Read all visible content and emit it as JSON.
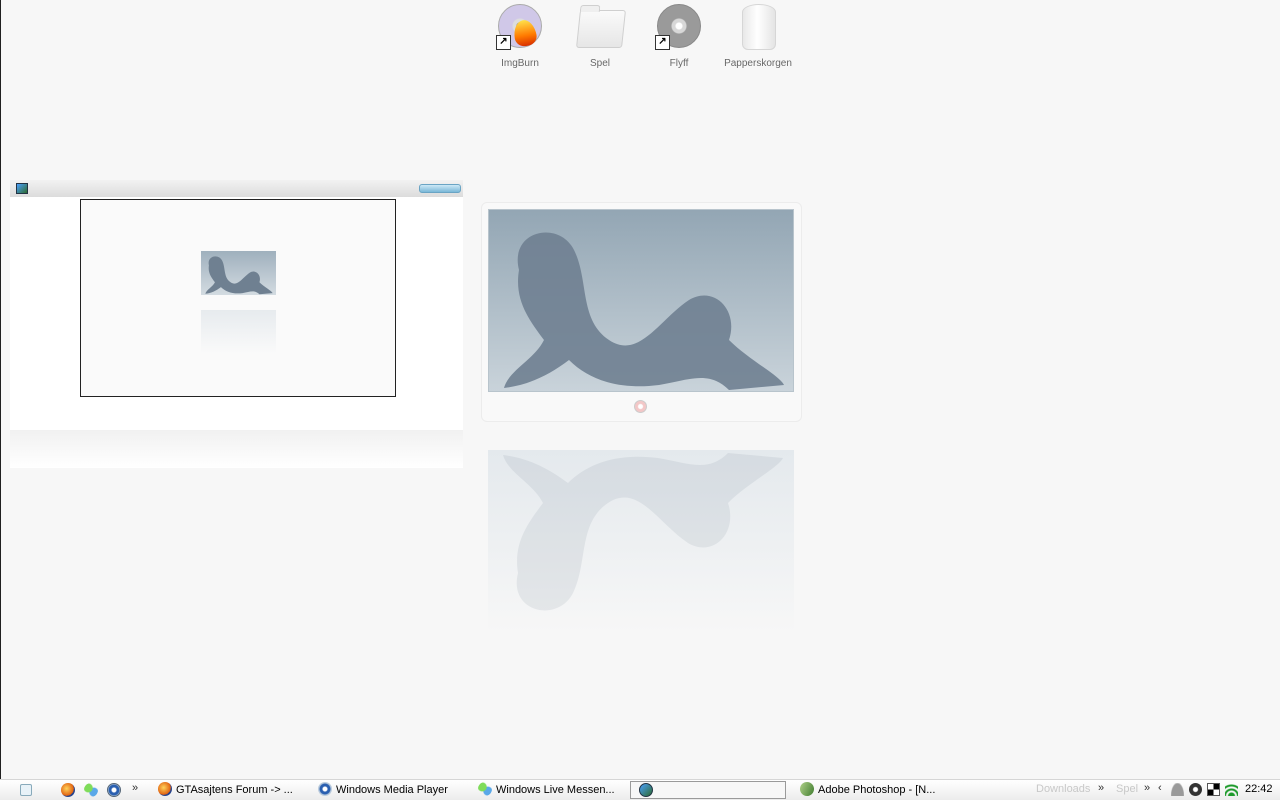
{
  "desktop": {
    "icons": [
      {
        "label": "ImgBurn",
        "icon": "imgburn-icon",
        "shortcut": true
      },
      {
        "label": "Spel",
        "icon": "folder-icon",
        "shortcut": false
      },
      {
        "label": "Flyff",
        "icon": "disc-icon",
        "shortcut": true
      },
      {
        "label": "Papperskorgen",
        "icon": "recycle-bin-icon",
        "shortcut": false
      }
    ]
  },
  "taskbar": {
    "quick_launch": [
      "firefox-icon",
      "messenger-icon",
      "media-player-icon"
    ],
    "tasks": [
      {
        "label": "GTAsajtens Forum -> ...",
        "icon": "firefox-icon",
        "active": false
      },
      {
        "label": "Windows Media Player",
        "icon": "media-player-icon",
        "active": false
      },
      {
        "label": "Windows Live Messen...",
        "icon": "messenger-icon",
        "active": false
      },
      {
        "label": "",
        "icon": "image-viewer-icon",
        "active": true
      },
      {
        "label": "Adobe Photoshop - [N...",
        "icon": "photoshop-icon",
        "active": false
      }
    ],
    "toolbars": [
      {
        "label": "Downloads"
      },
      {
        "label": "Spel"
      }
    ],
    "tray": {
      "icons": [
        "user-icon",
        "globe-icon",
        "checker-icon",
        "wifi-icon"
      ],
      "clock": "22:42"
    }
  },
  "colors": {
    "desktop_bg": "#f7f7f7",
    "photo_tint": "#93a6b4",
    "taskbar_bg": "#ececec"
  }
}
